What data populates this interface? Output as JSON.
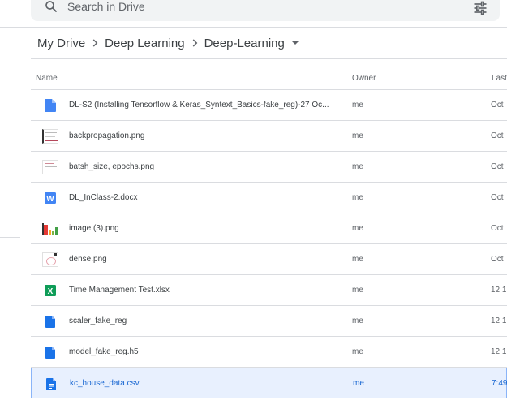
{
  "search": {
    "placeholder": "Search in Drive"
  },
  "breadcrumb": {
    "items": [
      "My Drive",
      "Deep Learning",
      "Deep-Learning"
    ]
  },
  "columns": {
    "name": "Name",
    "owner": "Owner",
    "last": "Last"
  },
  "files": [
    {
      "name": "DL-S2 (Installing Tensorflow & Keras_Syntext_Basics-fake_reg)-27 Oc...",
      "owner": "me",
      "date": "Oct",
      "icon": "google-doc-icon"
    },
    {
      "name": "backpropagation.png",
      "owner": "me",
      "date": "Oct",
      "icon": "image-thumbnail"
    },
    {
      "name": "batsh_size, epochs.png",
      "owner": "me",
      "date": "Oct",
      "icon": "image-thumbnail"
    },
    {
      "name": "DL_InClass-2.docx",
      "owner": "me",
      "date": "Oct",
      "icon": "word-icon"
    },
    {
      "name": "image (3).png",
      "owner": "me",
      "date": "Oct",
      "icon": "chart-thumbnail"
    },
    {
      "name": "dense.png",
      "owner": "me",
      "date": "Oct",
      "icon": "image-thumbnail"
    },
    {
      "name": "Time Management Test.xlsx",
      "owner": "me",
      "date": "12:1",
      "icon": "excel-icon"
    },
    {
      "name": "scaler_fake_reg",
      "owner": "me",
      "date": "12:1",
      "icon": "file-icon"
    },
    {
      "name": "model_fake_reg.h5",
      "owner": "me",
      "date": "12:1",
      "icon": "file-icon"
    },
    {
      "name": "kc_house_data.csv",
      "owner": "me",
      "date": "7:49",
      "icon": "google-doc-icon",
      "selected": true
    }
  ],
  "colors": {
    "accent": "#1a73e8",
    "selected_bg": "#e8f0fe",
    "word": "#4285f4",
    "excel": "#0f9d58"
  }
}
